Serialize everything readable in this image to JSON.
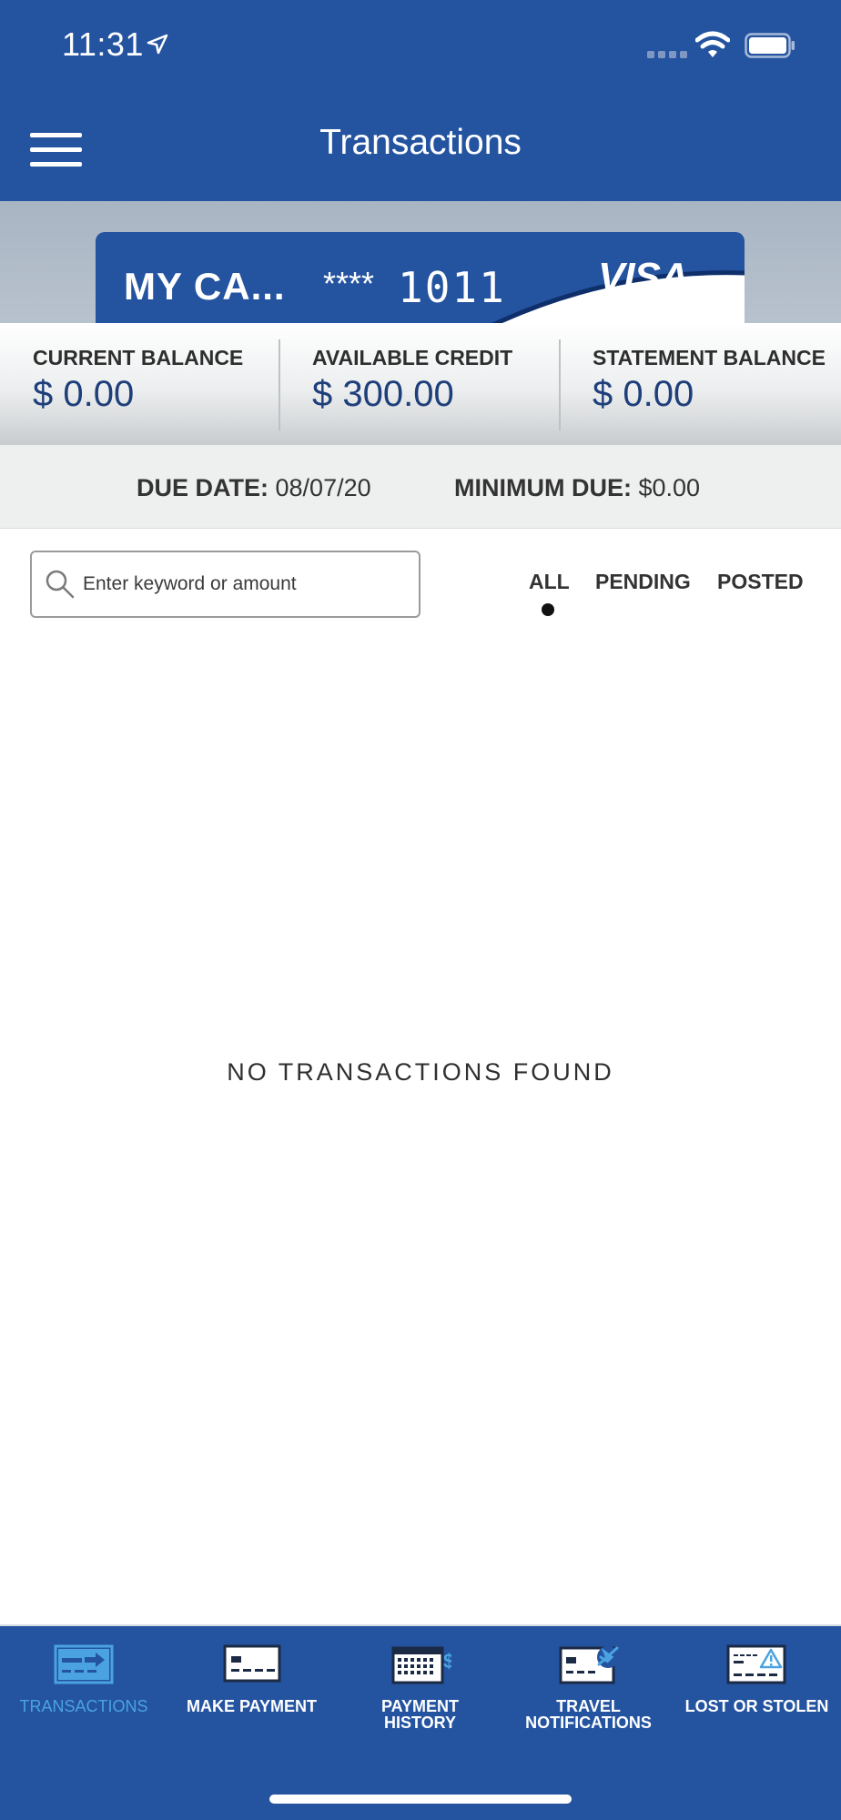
{
  "status_bar": {
    "time": "11:31",
    "icons": [
      "location-arrow-icon",
      "signal-icon",
      "wifi-icon",
      "battery-icon"
    ]
  },
  "header": {
    "menu_icon": "hamburger-menu-icon",
    "title": "Transactions"
  },
  "card": {
    "name": "MY CA...",
    "mask": "****",
    "last4": "1011",
    "brand": "VISA"
  },
  "balances": [
    {
      "label": "CURRENT BALANCE",
      "value": "$ 0.00"
    },
    {
      "label": "AVAILABLE CREDIT",
      "value": "$ 300.00"
    },
    {
      "label": "STATEMENT BALANCE",
      "value": "$ 0.00"
    }
  ],
  "due": {
    "date_label": "DUE DATE:",
    "date_value": "08/07/20",
    "min_label": "MINIMUM DUE:",
    "min_value": "$0.00"
  },
  "search": {
    "placeholder": "Enter keyword or amount",
    "value": ""
  },
  "filters": {
    "items": [
      "ALL",
      "PENDING",
      "POSTED"
    ],
    "selected": "ALL"
  },
  "empty_message": "NO TRANSACTIONS FOUND",
  "bottom_nav": {
    "items": [
      {
        "label": "TRANSACTIONS",
        "icon": "transactions-icon",
        "active": true
      },
      {
        "label": "MAKE PAYMENT",
        "icon": "make-payment-icon",
        "active": false
      },
      {
        "label_line1": "PAYMENT",
        "label_line2": "HISTORY",
        "icon": "payment-history-icon",
        "active": false
      },
      {
        "label_line1": "TRAVEL",
        "label_line2": "NOTIFICATIONS",
        "icon": "travel-notifications-icon",
        "active": false
      },
      {
        "label": "LOST OR STOLEN",
        "icon": "lost-or-stolen-icon",
        "active": false
      }
    ]
  },
  "colors": {
    "brand_blue": "#2453a0",
    "active_nav": "#4aa3e0",
    "balance_value": "#1e3f7a"
  }
}
